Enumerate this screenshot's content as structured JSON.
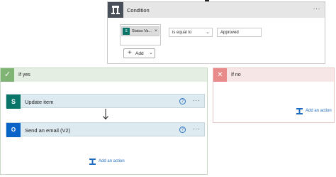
{
  "condition": {
    "title": "Condition",
    "more_label": "···",
    "token": {
      "label": "Status Va...",
      "remove_label": "×",
      "icon": "sharepoint-icon",
      "icon_text": "S",
      "color": "#077568"
    },
    "operator": {
      "selected": "is equal to",
      "chevron": "⌄"
    },
    "value": "Approved",
    "add_button": {
      "plus": "+",
      "label": "Add",
      "chevron": "⌄"
    }
  },
  "if_yes": {
    "title": "If yes",
    "check": "✓",
    "color": "#7fb474",
    "actions": [
      {
        "title": "Update item",
        "icon": "sharepoint-icon",
        "icon_text": "S",
        "help": "?",
        "more": "···",
        "color": "#077568"
      },
      {
        "title": "Send an email (V2)",
        "icon": "outlook-icon",
        "icon_text": "O",
        "help": "?",
        "more": "···",
        "color": "#0a64c7"
      }
    ],
    "add_action": "Add an action"
  },
  "if_no": {
    "title": "If no",
    "x": "✕",
    "color": "#e88a8a",
    "add_action": "Add an action"
  }
}
